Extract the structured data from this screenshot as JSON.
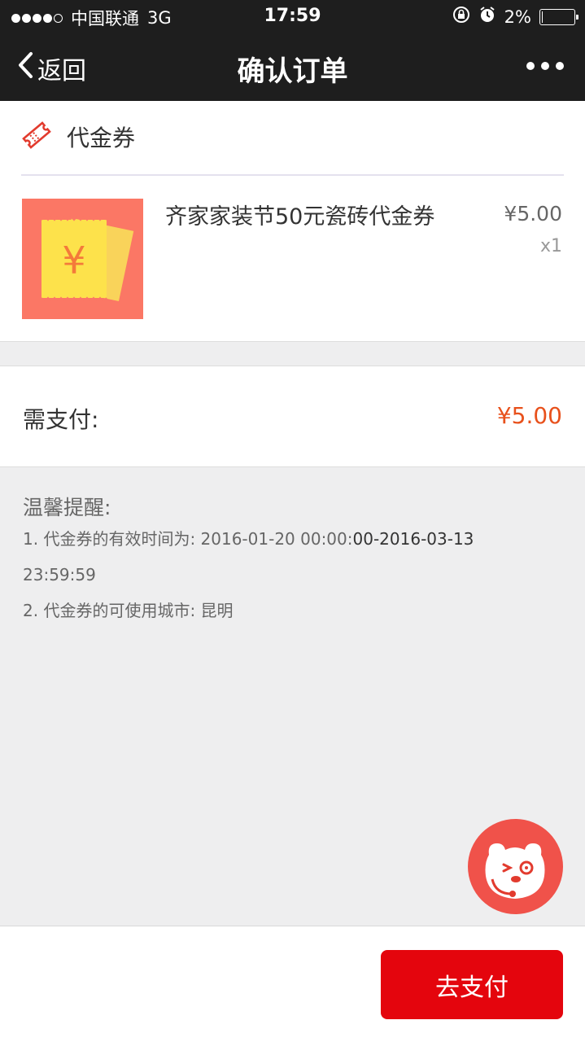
{
  "status_bar": {
    "carrier": "中国联通",
    "network": "3G",
    "time": "17:59",
    "battery": "2%",
    "battery_level": 0.02
  },
  "nav": {
    "back_label": "返回",
    "title": "确认订单"
  },
  "voucher_section": {
    "title": "代金券",
    "icon": "ticket-icon"
  },
  "product": {
    "name": "齐家家装节50元瓷砖代金券",
    "price": "¥5.00",
    "quantity": "x1",
    "image_icon": "yuan-coupon-icon"
  },
  "payment": {
    "label": "需支付:",
    "amount": "¥5.00"
  },
  "reminder": {
    "title": "温馨提醒:",
    "line1_a": "1. 代金券的有效时间为: 2016-01-20 00:00:",
    "line1_b": "00-2016-03-13",
    "line1_c": "23:59:59",
    "line2": "2. 代金券的可使用城市: 昆明"
  },
  "bottom": {
    "pay_button_label": "去支付"
  },
  "colors": {
    "accent_red": "#e4050d",
    "price_orange": "#e8511c",
    "image_bg": "#fb7765",
    "float_bg": "#f0524a"
  }
}
